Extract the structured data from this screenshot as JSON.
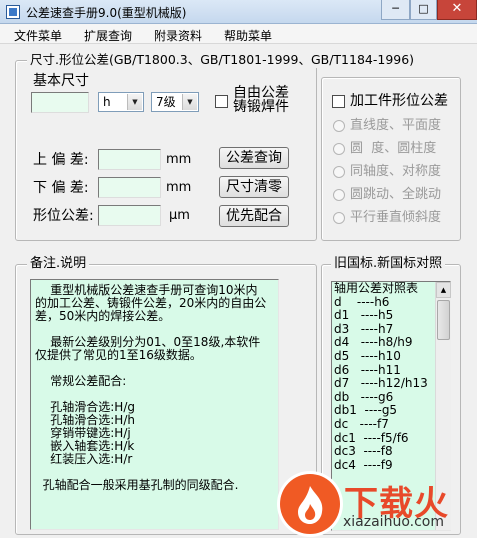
{
  "window": {
    "title": "公差速查手册9.0(重型机械版)",
    "minimize": "─",
    "maximize": "□",
    "close": "✕"
  },
  "menu": [
    "文件菜单",
    "扩展查询",
    "附录资料",
    "帮助菜单"
  ],
  "tolerance": {
    "group_title": "尺寸.形位公差(GB/T1800.3、GB/T1801-1999、GB/T1184-1996)",
    "basic_size_label": "基本尺寸",
    "basic_size_value": "",
    "fit_letter": "h",
    "grade": "7级",
    "free_tolerance_label_1": "自由公差",
    "free_tolerance_label_2": "铸锻焊件",
    "upper_dev_label": "上 偏 差:",
    "upper_dev_value": "",
    "lower_dev_label": "下 偏 差:",
    "lower_dev_value": "",
    "form_tol_label": "形位公差:",
    "form_tol_value": "",
    "unit_mm": "mm",
    "unit_um": "μm",
    "query_button": "公差查询",
    "clear_button": "尺寸清零",
    "preferred_button": "优先配合"
  },
  "form_position": {
    "checkbox_label": "加工件形位公差",
    "options": [
      "直线度、平面度",
      "圆  度、圆柱度",
      "同轴度、对称度",
      "圆跳动、全跳动",
      "平行垂直倾斜度"
    ]
  },
  "notes": {
    "group_title": "备注.说明",
    "lines": [
      "    重型机械版公差速查手册可查询10米内的加工公差、铸锻件公差，20米内的自由公差，50米内的焊接公差。",
      "",
      "    最新公差级别分为01、0至18级,本软件仅提供了常见的1至16级数据。",
      "",
      "    常规公差配合:",
      "",
      "    孔轴滑合选:H/g",
      "    孔轴滑合选:H/h",
      "    穿销带键选:H/j",
      "    嵌入轴套选:H/k",
      "    红装压入选:H/r",
      "",
      "  孔轴配合一般采用基孔制的同级配合."
    ]
  },
  "standards": {
    "group_title": "旧国标.新国标对照",
    "rows": [
      "轴用公差对照表",
      "d    ----h6",
      "d1   ----h5",
      "d3   ----h7",
      "d4   ----h8/h9",
      "d5   ----h10",
      "d6   ----h11",
      "d7   ----h12/h13",
      "db   ----g6",
      "db1  ----g5",
      "dc   ----f7",
      "dc1  ----f5/f6",
      "dc3  ----f8",
      "dc4  ----f9"
    ]
  },
  "watermark": {
    "brand": "下载火",
    "url": "xiazaihuo.com"
  },
  "colors": {
    "field_bg": "#e8fbef",
    "memo_bg": "#d8fae8",
    "logo_orange": "#f05a24"
  }
}
